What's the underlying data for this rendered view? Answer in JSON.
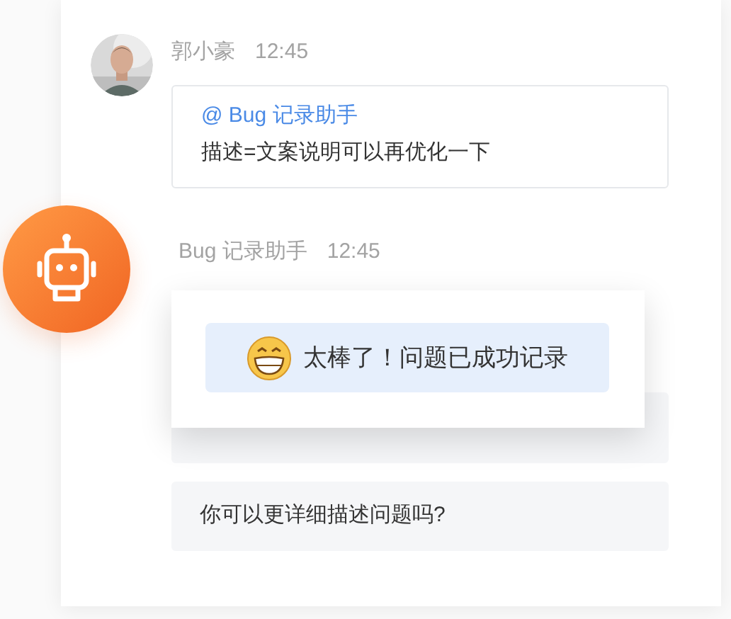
{
  "messages": [
    {
      "kind": "user",
      "sender": "郭小豪",
      "time": "12:45",
      "mention": "@ Bug 记录助手",
      "text": "描述=文案说明可以再优化一下"
    },
    {
      "kind": "bot",
      "sender": "Bug 记录助手",
      "time": "12:45",
      "replies": [
        {
          "kind": "covered"
        },
        {
          "kind": "text",
          "text": "你可以更详细描述问题吗?"
        }
      ]
    }
  ],
  "toast": {
    "text": "太棒了！问题已成功记录"
  }
}
